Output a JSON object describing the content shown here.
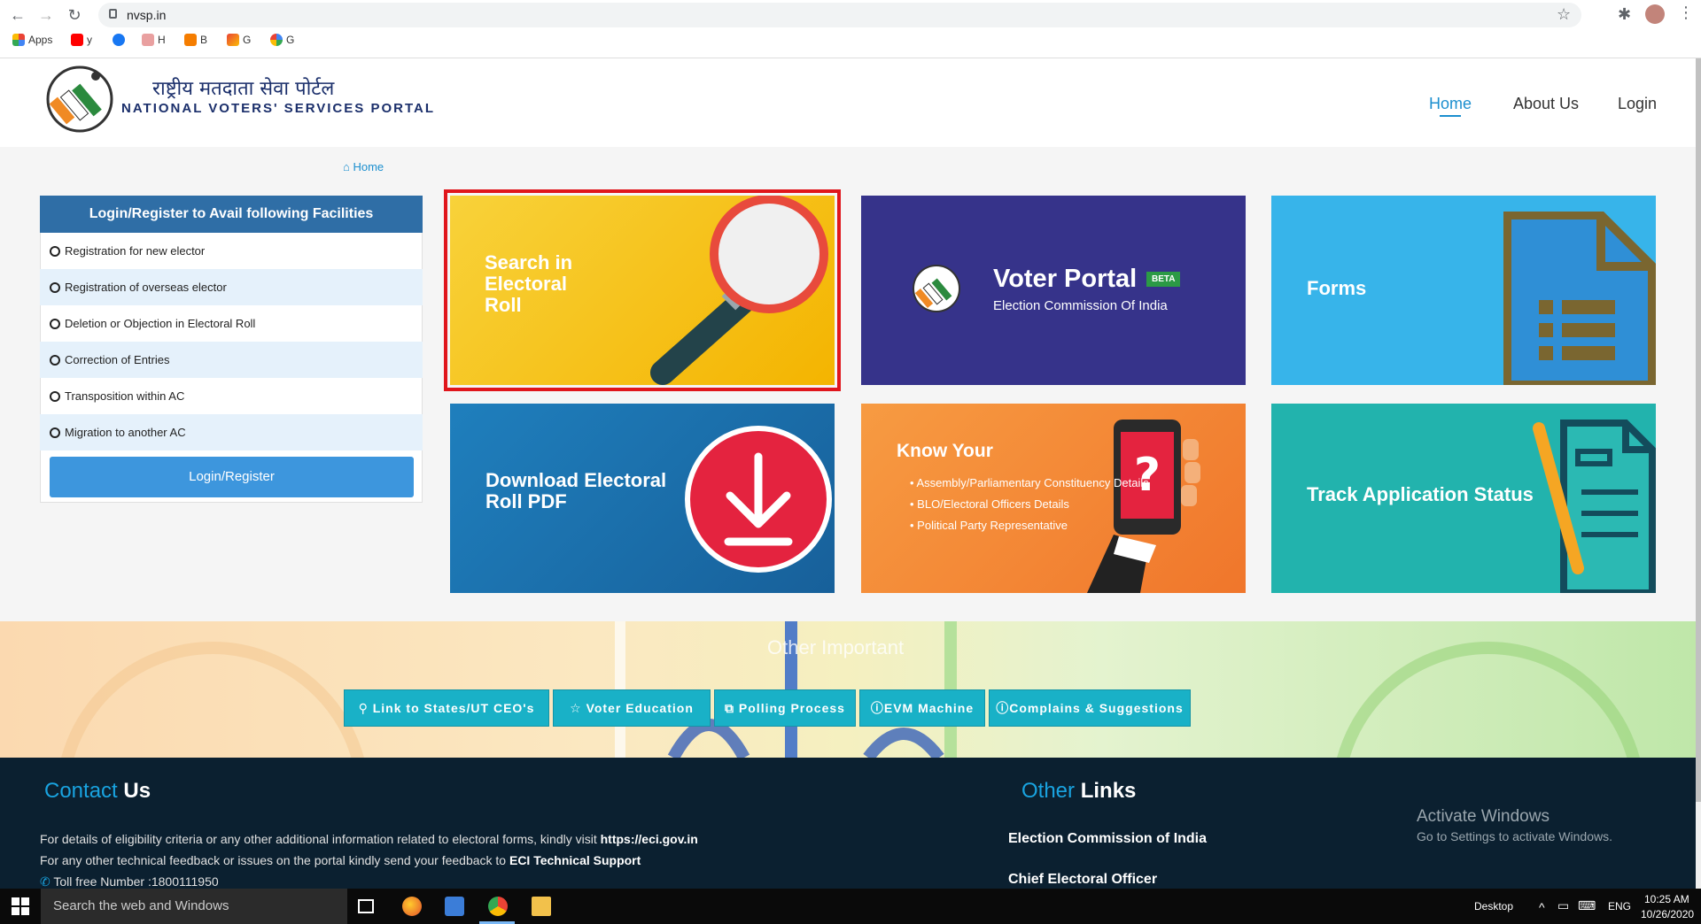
{
  "browser": {
    "url": "nvsp.in",
    "bookmarks": [
      {
        "label": "Apps"
      },
      {
        "label": "y"
      },
      {
        "label": ""
      },
      {
        "label": "H"
      },
      {
        "label": "B"
      },
      {
        "label": "G"
      },
      {
        "label": "G"
      }
    ]
  },
  "header": {
    "title_hindi": "राष्ट्रीय मतदाता सेवा पोर्टल",
    "title_english": "NATIONAL VOTERS' SERVICES PORTAL",
    "nav": {
      "home": "Home",
      "about": "About Us",
      "login": "Login"
    }
  },
  "breadcrumb": "Home",
  "facilities": {
    "heading": "Login/Register to Avail following Facilities",
    "items": [
      "Registration for new elector",
      "Registration of overseas elector",
      "Deletion or Objection in Electoral Roll",
      "Correction of Entries",
      "Transposition within AC",
      "Migration to another AC"
    ],
    "button": "Login/Register"
  },
  "tiles": {
    "search": {
      "line1": "Search in",
      "line2": "Electoral",
      "line3": "Roll"
    },
    "voter_portal": {
      "title": "Voter Portal",
      "badge": "BETA",
      "subtitle": "Election Commission Of India"
    },
    "forms": {
      "title": "Forms"
    },
    "download": {
      "line1": "Download Electoral",
      "line2": "Roll PDF"
    },
    "know": {
      "title": "Know Your",
      "items": [
        "Assembly/Parliamentary Constituency Details",
        "BLO/Electoral Officers Details",
        "Political Party Representative"
      ]
    },
    "track": {
      "title": "Track Application Status"
    }
  },
  "other_important": {
    "title": "Other Important",
    "buttons": [
      "Link to States/UT CEO's",
      "Voter Education",
      "Polling Process",
      "EVM Machine",
      "Complains & Suggestions"
    ]
  },
  "footer": {
    "contact_a": "Contact",
    "contact_b": "Us",
    "line1_text": "For details of eligibility criteria or any other additional information related to electoral forms, kindly visit ",
    "line1_link": "https://eci.gov.in",
    "line2_text": "For any other technical feedback or issues on the portal kindly send your feedback to ",
    "line2_link": "ECI Technical Support",
    "tollfree": "Toll free Number :1800111950",
    "other_a": "Other",
    "other_b": "Links",
    "links": [
      "Election Commission of India",
      "Chief Electoral Officer"
    ],
    "watermark_title": "Activate Windows",
    "watermark_sub": "Go to Settings to activate Windows."
  },
  "taskbar": {
    "search_placeholder": "Search the web and Windows",
    "desktop_label": "Desktop",
    "language": "ENG",
    "time": "10:25 AM",
    "date": "10/26/2020"
  },
  "colors": {
    "brand_blue": "#1c8fcf",
    "panel_head": "#2f6ea6",
    "highlight_red": "#e0161c",
    "quick_btn": "#19b1c7",
    "footer_bg": "#0b2030"
  }
}
